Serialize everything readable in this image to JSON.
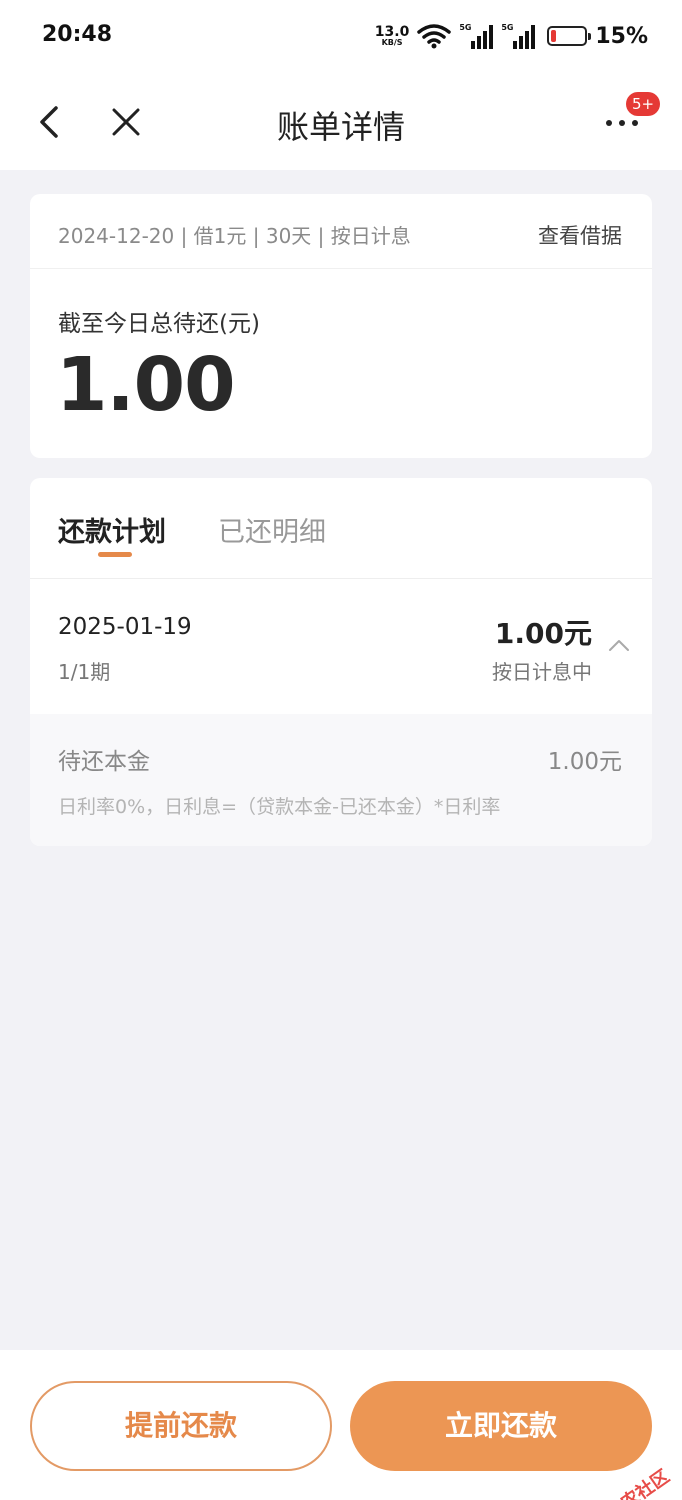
{
  "status_bar": {
    "time": "20:48",
    "net_speed_value": "13.0",
    "net_speed_unit": "KB/S",
    "signal1_label": "5G",
    "signal2_label": "5G",
    "battery_percent": "15%"
  },
  "nav": {
    "title": "账单详情",
    "more_badge": "5+"
  },
  "summary": {
    "meta": "2024-12-20 | 借1元 | 30天 | 按日计息",
    "view_iou_label": "查看借据",
    "total_label": "截至今日总待还(元)",
    "total_amount": "1.00"
  },
  "plan": {
    "tabs": [
      {
        "label": "还款计划",
        "active": true
      },
      {
        "label": "已还明细",
        "active": false
      }
    ],
    "row": {
      "date": "2025-01-19",
      "period": "1/1期",
      "amount": "1.00元",
      "status": "按日计息中"
    },
    "detail": {
      "principal_label": "待还本金",
      "principal_value": "1.00元",
      "note": "日利率0%，日利息=（贷款本金-已还本金）*日利率"
    }
  },
  "actions": {
    "early_repay": "提前还款",
    "repay_now": "立即还款"
  },
  "watermark": "卡农社区",
  "colors": {
    "accent": "#ec9654",
    "accent_text": "#e5894a",
    "badge": "#e53935",
    "background": "#f2f2f6"
  }
}
